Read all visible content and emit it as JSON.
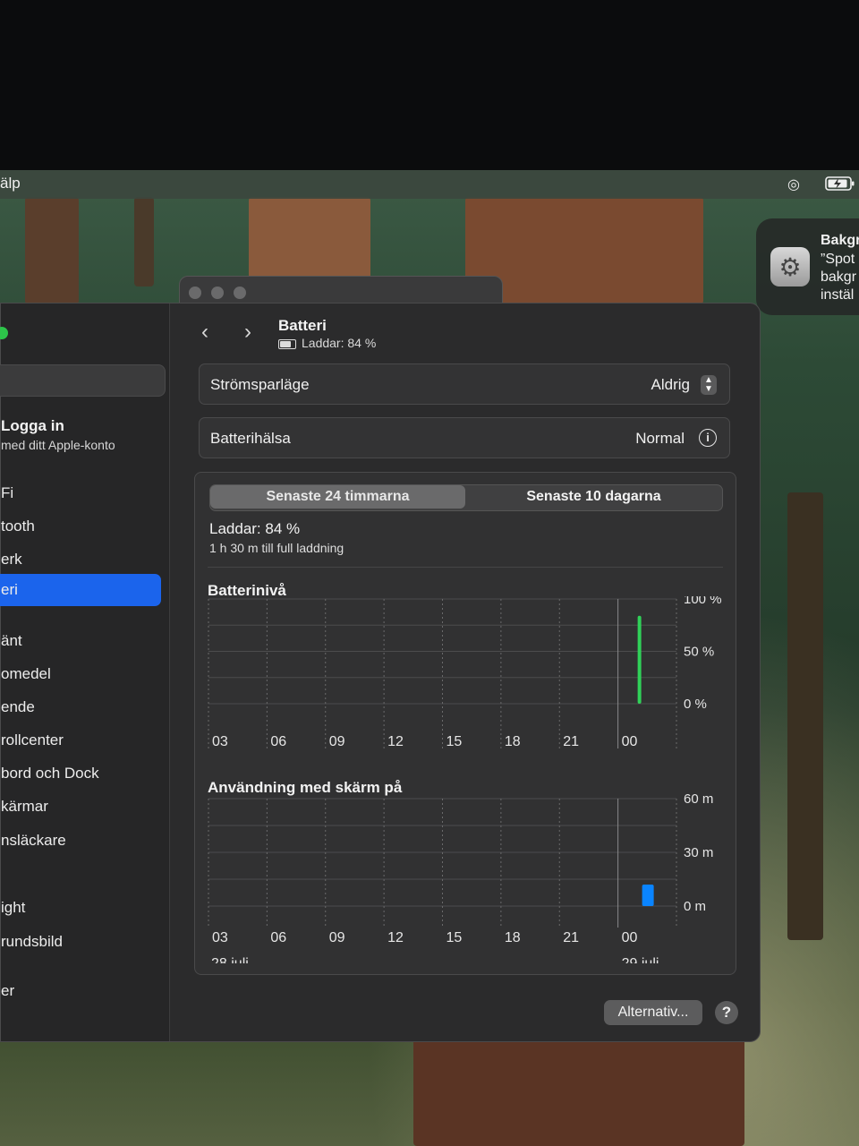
{
  "menubar": {
    "app_menu_fragment": "älp",
    "icons": [
      "airdrop-icon",
      "battery-charging-icon"
    ]
  },
  "notification": {
    "lines": [
      "Bakgr",
      "”Spot",
      "bakgr",
      "instäl"
    ],
    "icon": "gear-icon"
  },
  "sidebar": {
    "login_title": "Logga in",
    "login_subtitle": "med ditt Apple-konto",
    "items": [
      {
        "label": "Fi",
        "selected": false
      },
      {
        "label": "tooth",
        "selected": false
      },
      {
        "label": "erk",
        "selected": false
      },
      {
        "label": "eri",
        "selected": true
      },
      {
        "label": "änt",
        "selected": false
      },
      {
        "label": "omedel",
        "selected": false
      },
      {
        "label": "ende",
        "selected": false
      },
      {
        "label": "rollcenter",
        "selected": false
      },
      {
        "label": "bord och Dock",
        "selected": false
      },
      {
        "label": "kärmar",
        "selected": false
      },
      {
        "label": "nsläckare",
        "selected": false
      },
      {
        "label": "ight",
        "selected": false
      },
      {
        "label": "rundsbild",
        "selected": false
      },
      {
        "label": "er",
        "selected": false
      }
    ]
  },
  "header": {
    "title": "Batteri",
    "subtitle": "Laddar: 84 %"
  },
  "rows": {
    "low_power_label": "Strömsparläge",
    "low_power_value": "Aldrig",
    "health_label": "Batterihälsa",
    "health_value": "Normal"
  },
  "tabs": [
    {
      "label": "Senaste 24 timmarna",
      "active": true
    },
    {
      "label": "Senaste 10 dagarna",
      "active": false
    }
  ],
  "charge": {
    "status": "Laddar: 84 %",
    "time_remaining": "1 h 30 m till full laddning"
  },
  "colors": {
    "accent": "#1b64ec",
    "battery_green": "#30d158",
    "usage_blue": "#0a84ff"
  },
  "chart_data": [
    {
      "type": "bar",
      "title": "Batterinivå",
      "categories": [
        "03",
        "06",
        "09",
        "12",
        "15",
        "18",
        "21",
        "00"
      ],
      "y_ticks": [
        "100 %",
        "50 %",
        "0 %"
      ],
      "ylim": [
        0,
        100
      ],
      "series": [
        {
          "values": [
            null,
            null,
            null,
            null,
            null,
            null,
            null,
            84
          ]
        }
      ],
      "grid": true
    },
    {
      "type": "bar",
      "title": "Användning med skärm på",
      "categories": [
        "03",
        "06",
        "09",
        "12",
        "15",
        "18",
        "21",
        "00"
      ],
      "date_labels": [
        "28 juli",
        "29 juli"
      ],
      "y_ticks": [
        "60 m",
        "30 m",
        "0 m"
      ],
      "ylim": [
        0,
        60
      ],
      "series": [
        {
          "values": [
            0,
            0,
            0,
            0,
            0,
            0,
            0,
            12
          ]
        }
      ],
      "grid": true
    }
  ],
  "footer": {
    "options_label": "Alternativ...",
    "help_label": "?"
  }
}
